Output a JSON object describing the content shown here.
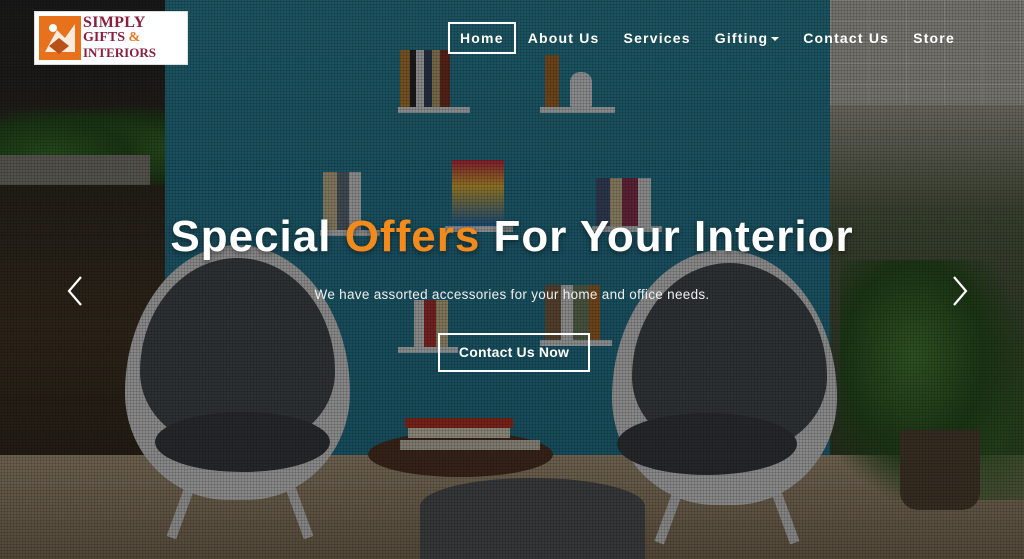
{
  "logo": {
    "line1": "SIMPLY",
    "line2": "GIFTS",
    "amp": "&",
    "line3": "INTERIORS"
  },
  "nav": {
    "items": [
      {
        "label": "Home",
        "active": true
      },
      {
        "label": "About Us",
        "active": false
      },
      {
        "label": "Services",
        "active": false
      },
      {
        "label": "Gifting",
        "active": false,
        "dropdown": true
      },
      {
        "label": "Contact Us",
        "active": false
      },
      {
        "label": "Store",
        "active": false
      }
    ]
  },
  "hero": {
    "headline_part1": "Special ",
    "headline_accent": "Offers",
    "headline_part2": " For Your Interior",
    "subline": "We have assorted accessories for your home and office needs.",
    "cta_label": "Contact Us Now",
    "prev_icon": "chevron-left-icon",
    "next_icon": "chevron-right-icon"
  },
  "colors": {
    "accent": "#f28a1c",
    "brand": "#8b1e3f",
    "wall": "#2f8fa6"
  }
}
